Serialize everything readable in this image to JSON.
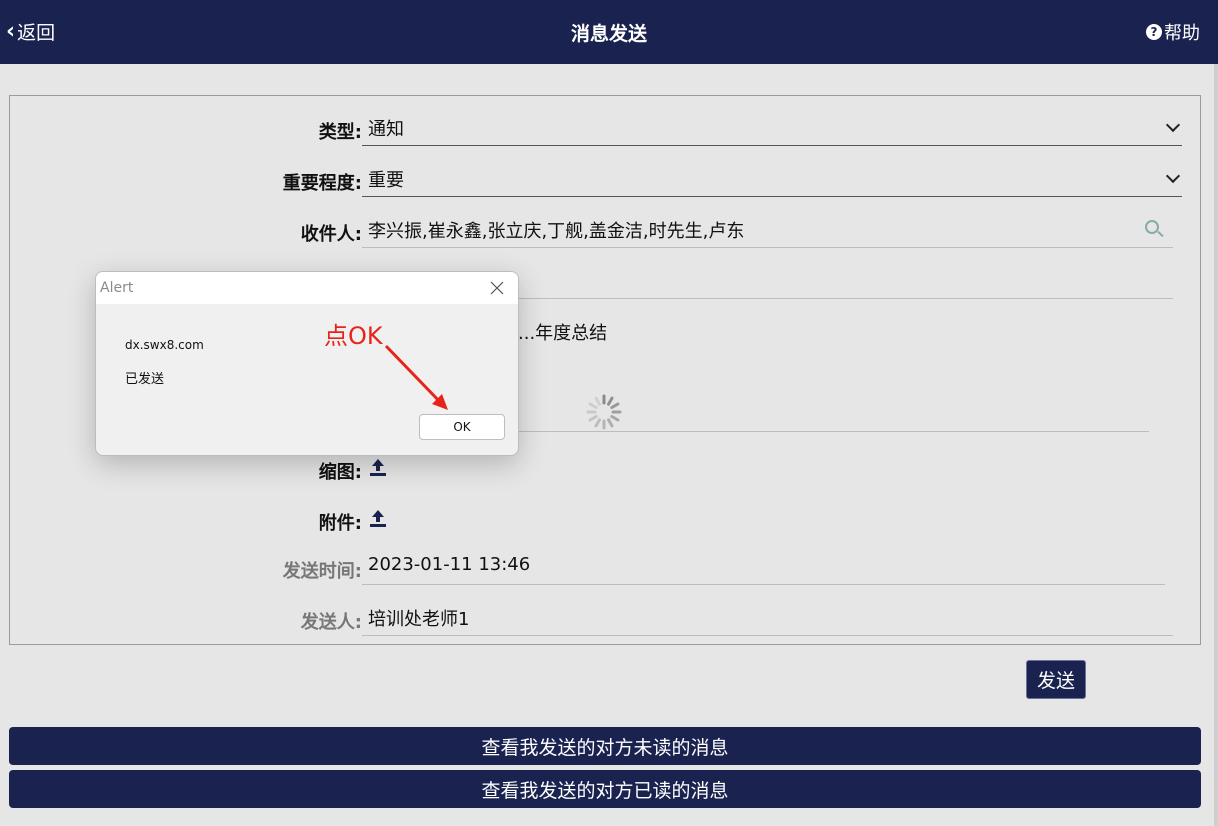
{
  "header": {
    "back_label": "返回",
    "title": "消息发送",
    "help_label": "帮助"
  },
  "form": {
    "type": {
      "label": "类型:",
      "value": "通知"
    },
    "importance": {
      "label": "重要程度:",
      "value": "重要"
    },
    "recipients": {
      "label": "收件人:",
      "value": "李兴振,崔永鑫,张立庆,丁舰,盖金洁,时先生,卢东"
    },
    "subject": {
      "value": "...年度总结"
    },
    "thumbnail": {
      "label": "缩图:"
    },
    "attachment": {
      "label": "附件:"
    },
    "send_time": {
      "label": "发送时间:",
      "value": "2023-01-11 13:46"
    },
    "sender": {
      "label": "发送人:",
      "value": "培训处老师1"
    }
  },
  "send_button": "发送",
  "buttons": {
    "unread": "查看我发送的对方未读的消息",
    "read": "查看我发送的对方已读的消息"
  },
  "alert": {
    "title": "Alert",
    "host": "dx.swx8.com",
    "message": "已发送",
    "ok_label": "OK"
  },
  "annotation": {
    "text": "点OK",
    "color": "#e8231b"
  },
  "colors": {
    "header_bg": "#1a2350",
    "page_bg": "#e6e6e6"
  }
}
